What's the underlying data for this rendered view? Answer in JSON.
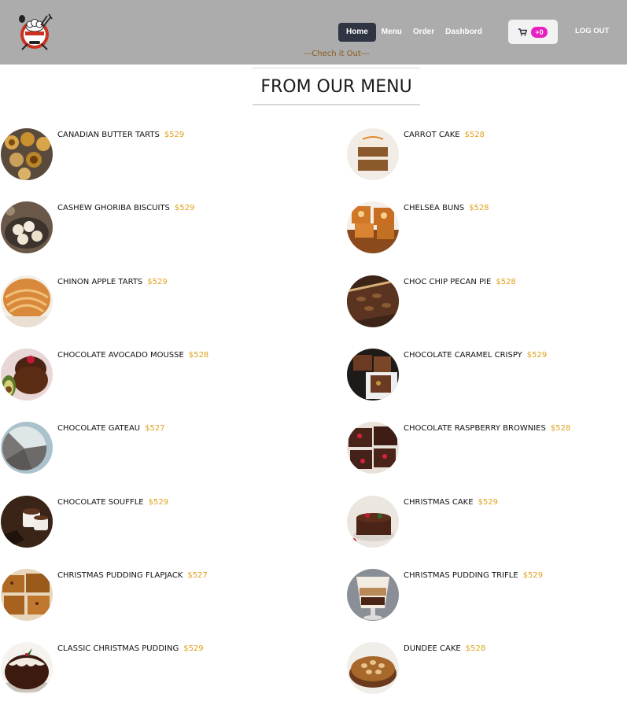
{
  "nav": {
    "links": [
      {
        "label": "Home"
      },
      {
        "label": "Menu"
      },
      {
        "label": "Order"
      },
      {
        "label": "Dashbord"
      }
    ],
    "cart_count": "+0",
    "logout": "LOG OUT",
    "tagline": "---Chech it Out---"
  },
  "page": {
    "title": "FROM OUR MENU"
  },
  "menu": {
    "left": [
      {
        "name": "Canadian Butter Tarts",
        "price": "$529"
      },
      {
        "name": "Cashew Ghoriba Biscuits",
        "price": "$529"
      },
      {
        "name": "Chinon Apple Tarts",
        "price": "$529"
      },
      {
        "name": "Chocolate Avocado Mousse",
        "price": "$528"
      },
      {
        "name": "Chocolate Gateau",
        "price": "$527"
      },
      {
        "name": "Chocolate Souffle",
        "price": "$529"
      },
      {
        "name": "Christmas Pudding Flapjack",
        "price": "$527"
      },
      {
        "name": "Classic Christmas Pudding",
        "price": "$529"
      }
    ],
    "right": [
      {
        "name": "Carrot Cake",
        "price": "$528"
      },
      {
        "name": "Chelsea Buns",
        "price": "$528"
      },
      {
        "name": "Choc Chip Pecan Pie",
        "price": "$528"
      },
      {
        "name": "Chocolate Caramel Crispy",
        "price": "$529"
      },
      {
        "name": "Chocolate Raspberry Brownies",
        "price": "$528"
      },
      {
        "name": "Christmas Cake",
        "price": "$529"
      },
      {
        "name": "Christmas Pudding Trifle",
        "price": "$529"
      },
      {
        "name": "Dundee Cake",
        "price": "$528"
      }
    ]
  },
  "colors": {
    "navbar_bg": "#acacac",
    "active_link_bg": "#2f3542",
    "cart_badge": "#e91ec0",
    "price": "#e0a11c",
    "tagline": "#8b5a1a"
  }
}
